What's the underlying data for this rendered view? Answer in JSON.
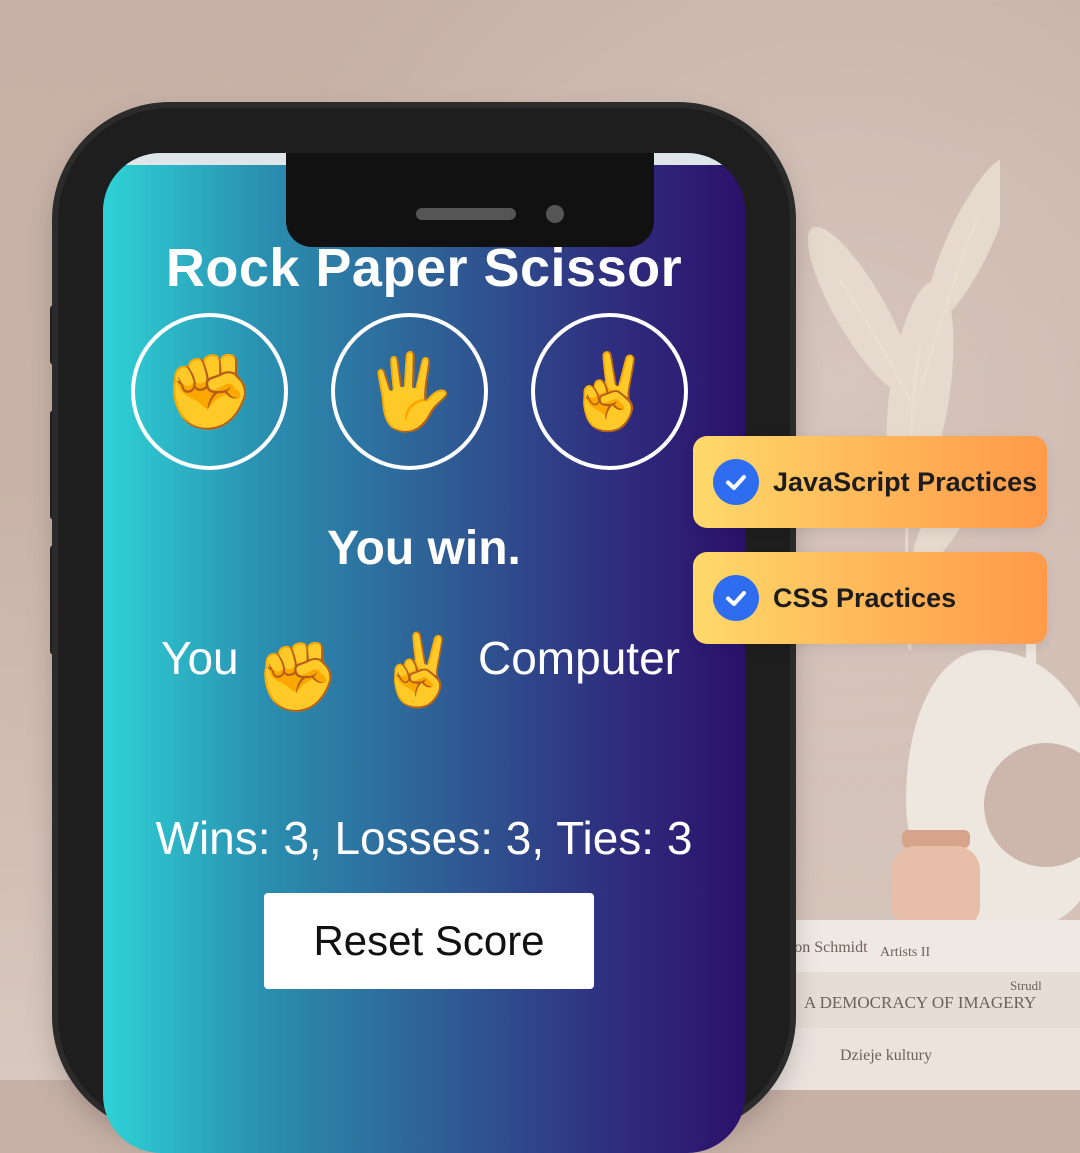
{
  "game": {
    "title": "Rock Paper Scissor",
    "moves": [
      {
        "name": "rock",
        "icon": "✊"
      },
      {
        "name": "paper",
        "icon": "🖐"
      },
      {
        "name": "scissors",
        "icon": "✌"
      }
    ],
    "result": "You win.",
    "you_label": "You",
    "computer_label": "Computer",
    "player_move_icon": "✊",
    "computer_move_icon": "✌",
    "score": "Wins: 3, Losses: 3, Ties: 3",
    "reset_label": "Reset Score"
  },
  "badges": [
    {
      "label": "JavaScript Practices",
      "icon": "check-circle-icon"
    },
    {
      "label": "CSS Practices",
      "icon": "check-circle-icon"
    }
  ],
  "books": [
    "son Schmidt",
    "Artists II",
    "A DEMOCRACY OF IMAGERY",
    "Strudl",
    "Dzieje kultury"
  ],
  "colors": {
    "gradient_start": "#2ed3d6",
    "gradient_end": "#2c116b",
    "badge_start": "#ffd96a",
    "badge_end": "#ff9a4a",
    "check": "#2f6df0"
  }
}
